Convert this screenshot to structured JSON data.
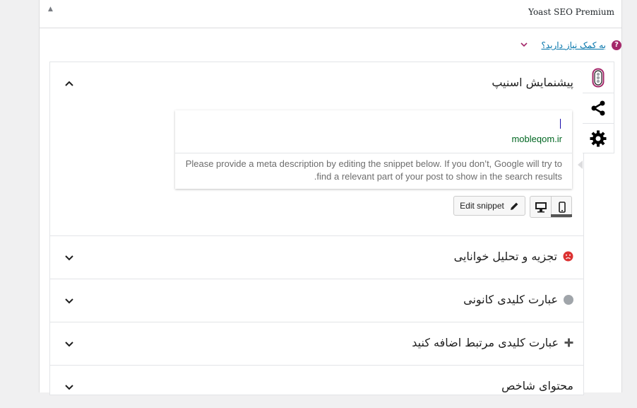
{
  "box": {
    "title": "Yoast SEO Premium"
  },
  "help": {
    "link": "به کمک نیاز دارید؟"
  },
  "sidebar": {
    "items": [
      {
        "name": "seo-analysis",
        "icon": "traffic-light-icon"
      },
      {
        "name": "social",
        "icon": "share-icon"
      },
      {
        "name": "settings",
        "icon": "gear-icon"
      }
    ]
  },
  "sections": {
    "snippet": {
      "title": "پیشنمایش اسنیپ"
    },
    "readability": {
      "title": "تجزیه و تحلیل خوانایی"
    },
    "keyphrase": {
      "title": "عبارت کلیدی کانونی"
    },
    "related": {
      "title": "عبارت کلیدی مرتبط اضافه کنید"
    },
    "cornerstone": {
      "title": "محتوای شاخص"
    }
  },
  "snippet": {
    "url": "mobleqom.ir",
    "description": "Please provide a meta description by editing the snippet below. If you don’t, Google will try to find a relevant part of your post to show in the search results.",
    "edit_label": "Edit snippet",
    "preview_mode": "mobile"
  },
  "colors": {
    "brand": "#a4286a",
    "link": "#0073aa",
    "url_green": "#006621",
    "bad": "#dc3232",
    "neutral": "#a0a5aa"
  }
}
